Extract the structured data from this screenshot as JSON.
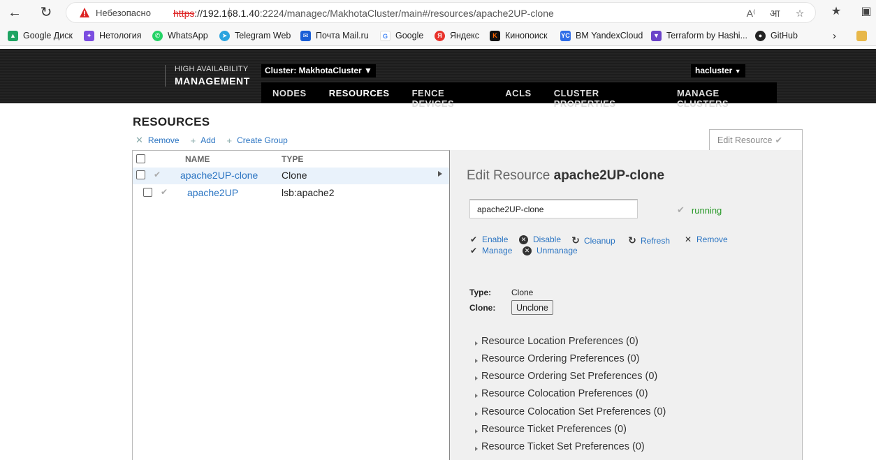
{
  "browser": {
    "insecure_label": "Небезопасно",
    "url_proto": "https",
    "url_host": "://192.168.1.40",
    "url_rest": ":2224/managec/MakhotaCluster/main#/resources/apache2UP-clone",
    "bookmarks": [
      {
        "label": "Google Диск",
        "icon": "google-drive-icon",
        "color": "#1fa463"
      },
      {
        "label": "Нетология",
        "icon": "netology-icon",
        "color": "#7b4de0"
      },
      {
        "label": "WhatsApp",
        "icon": "whatsapp-icon",
        "color": "#25d366"
      },
      {
        "label": "Telegram Web",
        "icon": "telegram-icon",
        "color": "#2aa3df"
      },
      {
        "label": "Почта Mail.ru",
        "icon": "mail-icon",
        "color": "#1a5ed6"
      },
      {
        "label": "Google",
        "icon": "google-icon",
        "color": "#4285f4"
      },
      {
        "label": "Яндекс",
        "icon": "yandex-icon",
        "color": "#e8322b"
      },
      {
        "label": "Кинопоиск",
        "icon": "kinopoisk-icon",
        "color": "#111111"
      },
      {
        "label": "ВМ YandexCloud",
        "icon": "yandexcloud-icon",
        "color": "#2f6de8"
      },
      {
        "label": "Terraform by Hashi...",
        "icon": "terraform-icon",
        "color": "#6b43c9"
      },
      {
        "label": "GitHub",
        "icon": "github-icon",
        "color": "#222222"
      }
    ]
  },
  "header": {
    "brand_small": "HIGH AVAILABILITY",
    "brand_big": "MANAGEMENT",
    "cluster_select": "Cluster: MakhotaCluster",
    "user_select": "hacluster",
    "nav": [
      "NODES",
      "RESOURCES",
      "FENCE DEVICES",
      "ACLS",
      "CLUSTER PROPERTIES",
      "MANAGE CLUSTERS"
    ],
    "active_nav": "RESOURCES"
  },
  "page": {
    "title": "RESOURCES",
    "actions": {
      "remove": "Remove",
      "add": "Add",
      "create_group": "Create Group"
    },
    "edit_tab": "Edit Resource"
  },
  "table": {
    "columns": {
      "name": "NAME",
      "type": "TYPE"
    },
    "rows": [
      {
        "name": "apache2UP-clone",
        "type": "Clone"
      },
      {
        "name": "apache2UP",
        "type": "lsb:apache2"
      }
    ]
  },
  "detail": {
    "title_prefix": "Edit Resource",
    "title_name": "apache2UP-clone",
    "input_value": "apache2UP-clone",
    "status": "running",
    "ops": {
      "enable": "Enable",
      "disable": "Disable",
      "cleanup": "Cleanup",
      "refresh": "Refresh",
      "remove": "Remove",
      "manage": "Manage",
      "unmanage": "Unmanage"
    },
    "type_label": "Type:",
    "type_value": "Clone",
    "clone_label": "Clone:",
    "unclone_button": "Unclone",
    "preferences": [
      "Resource Location Preferences (0)",
      "Resource Ordering Preferences (0)",
      "Resource Ordering Set Preferences (0)",
      "Resource Colocation Preferences (0)",
      "Resource Colocation Set Preferences (0)",
      "Resource Ticket Preferences (0)",
      "Resource Ticket Set Preferences (0)"
    ]
  }
}
